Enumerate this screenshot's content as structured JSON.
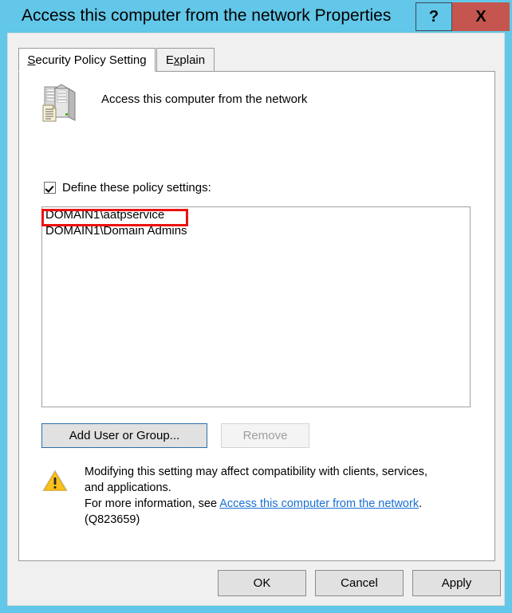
{
  "window": {
    "title": "Access this computer from the network Properties",
    "titlebar_color": "#62c7e8",
    "close_button_color": "#c4564f",
    "help_button_label": "?",
    "close_button_label": "X"
  },
  "tabs": [
    {
      "label": "Security Policy Setting",
      "accelerator": "S",
      "active": true
    },
    {
      "label": "Explain",
      "accelerator": "x",
      "active": false
    }
  ],
  "policy": {
    "icon": "server-policy-icon",
    "name": "Access this computer from the network"
  },
  "define_setting": {
    "label": "Define these policy settings:",
    "checked": true
  },
  "list": {
    "items": [
      "DOMAIN1\\aatpservice",
      "DOMAIN1\\Domain Admins"
    ],
    "annotated_item_index": 0,
    "annotation_color": "#ee1111"
  },
  "actions": {
    "add_label": "Add User or Group...",
    "remove_label": "Remove",
    "remove_enabled": false
  },
  "warning": {
    "icon": "warning-triangle-icon",
    "line1": "Modifying this setting may affect compatibility with clients, services,",
    "line2": "and applications.",
    "line3_prefix": "For more information, see ",
    "link_text": "Access this computer from the network",
    "line3_suffix": ".",
    "line4": "(Q823659)",
    "link_color": "#1a6fd4"
  },
  "footer": {
    "ok_label": "OK",
    "cancel_label": "Cancel",
    "apply_label": "Apply"
  }
}
